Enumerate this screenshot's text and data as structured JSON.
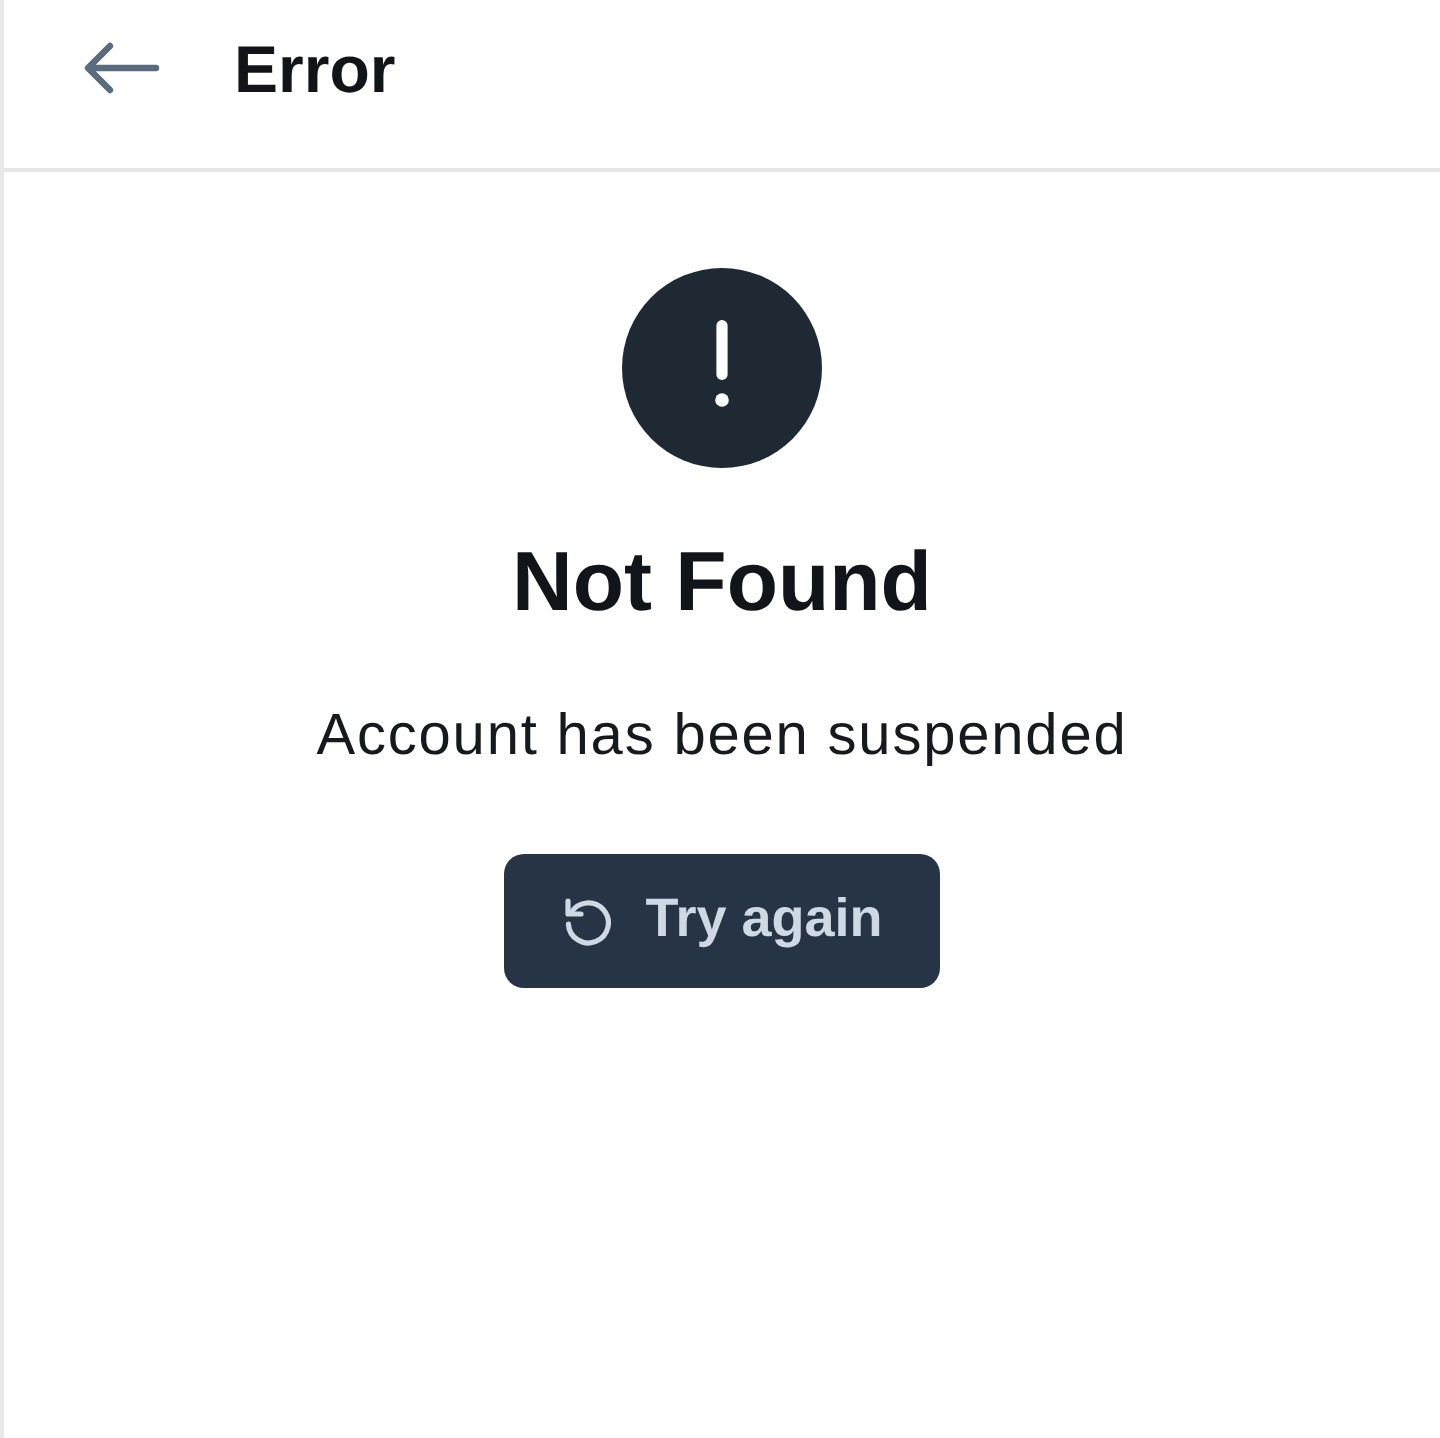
{
  "header": {
    "title": "Error"
  },
  "error": {
    "title": "Not Found",
    "message": "Account has been suspended",
    "retry_button": {
      "label": "Try again"
    }
  }
}
